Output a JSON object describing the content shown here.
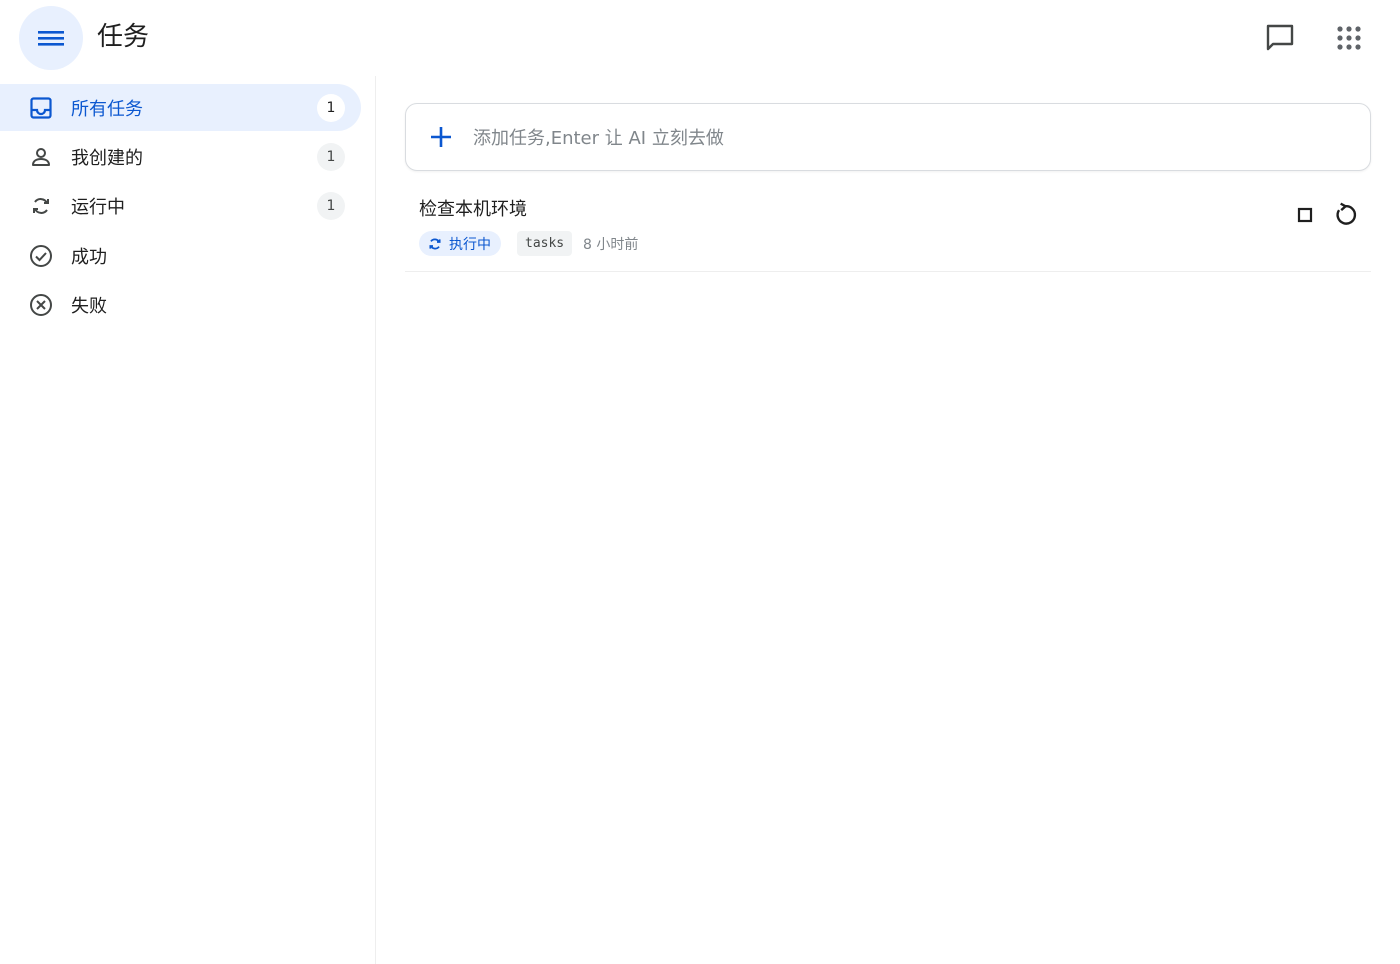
{
  "header": {
    "title": "任务"
  },
  "sidebar": {
    "items": [
      {
        "label": "所有任务",
        "count": "1",
        "icon": "inbox-icon",
        "active": true
      },
      {
        "label": "我创建的",
        "count": "1",
        "icon": "person-icon"
      },
      {
        "label": "运行中",
        "count": "1",
        "icon": "sync-icon"
      },
      {
        "label": "成功",
        "icon": "check-circle-icon"
      },
      {
        "label": "失败",
        "icon": "cancel-circle-icon"
      }
    ]
  },
  "add_task": {
    "placeholder": "添加任务,Enter 让 AI 立刻去做",
    "value": ""
  },
  "tasks": [
    {
      "title": "检查本机环境",
      "status": "执行中",
      "tag": "tasks",
      "time": "8 小时前"
    }
  ],
  "colors": {
    "accent": "#0b57d0",
    "active_bg": "#e8f0fe",
    "chip_bg": "#f1f3f4",
    "text": "#1f1f1f",
    "muted": "#80868b"
  }
}
